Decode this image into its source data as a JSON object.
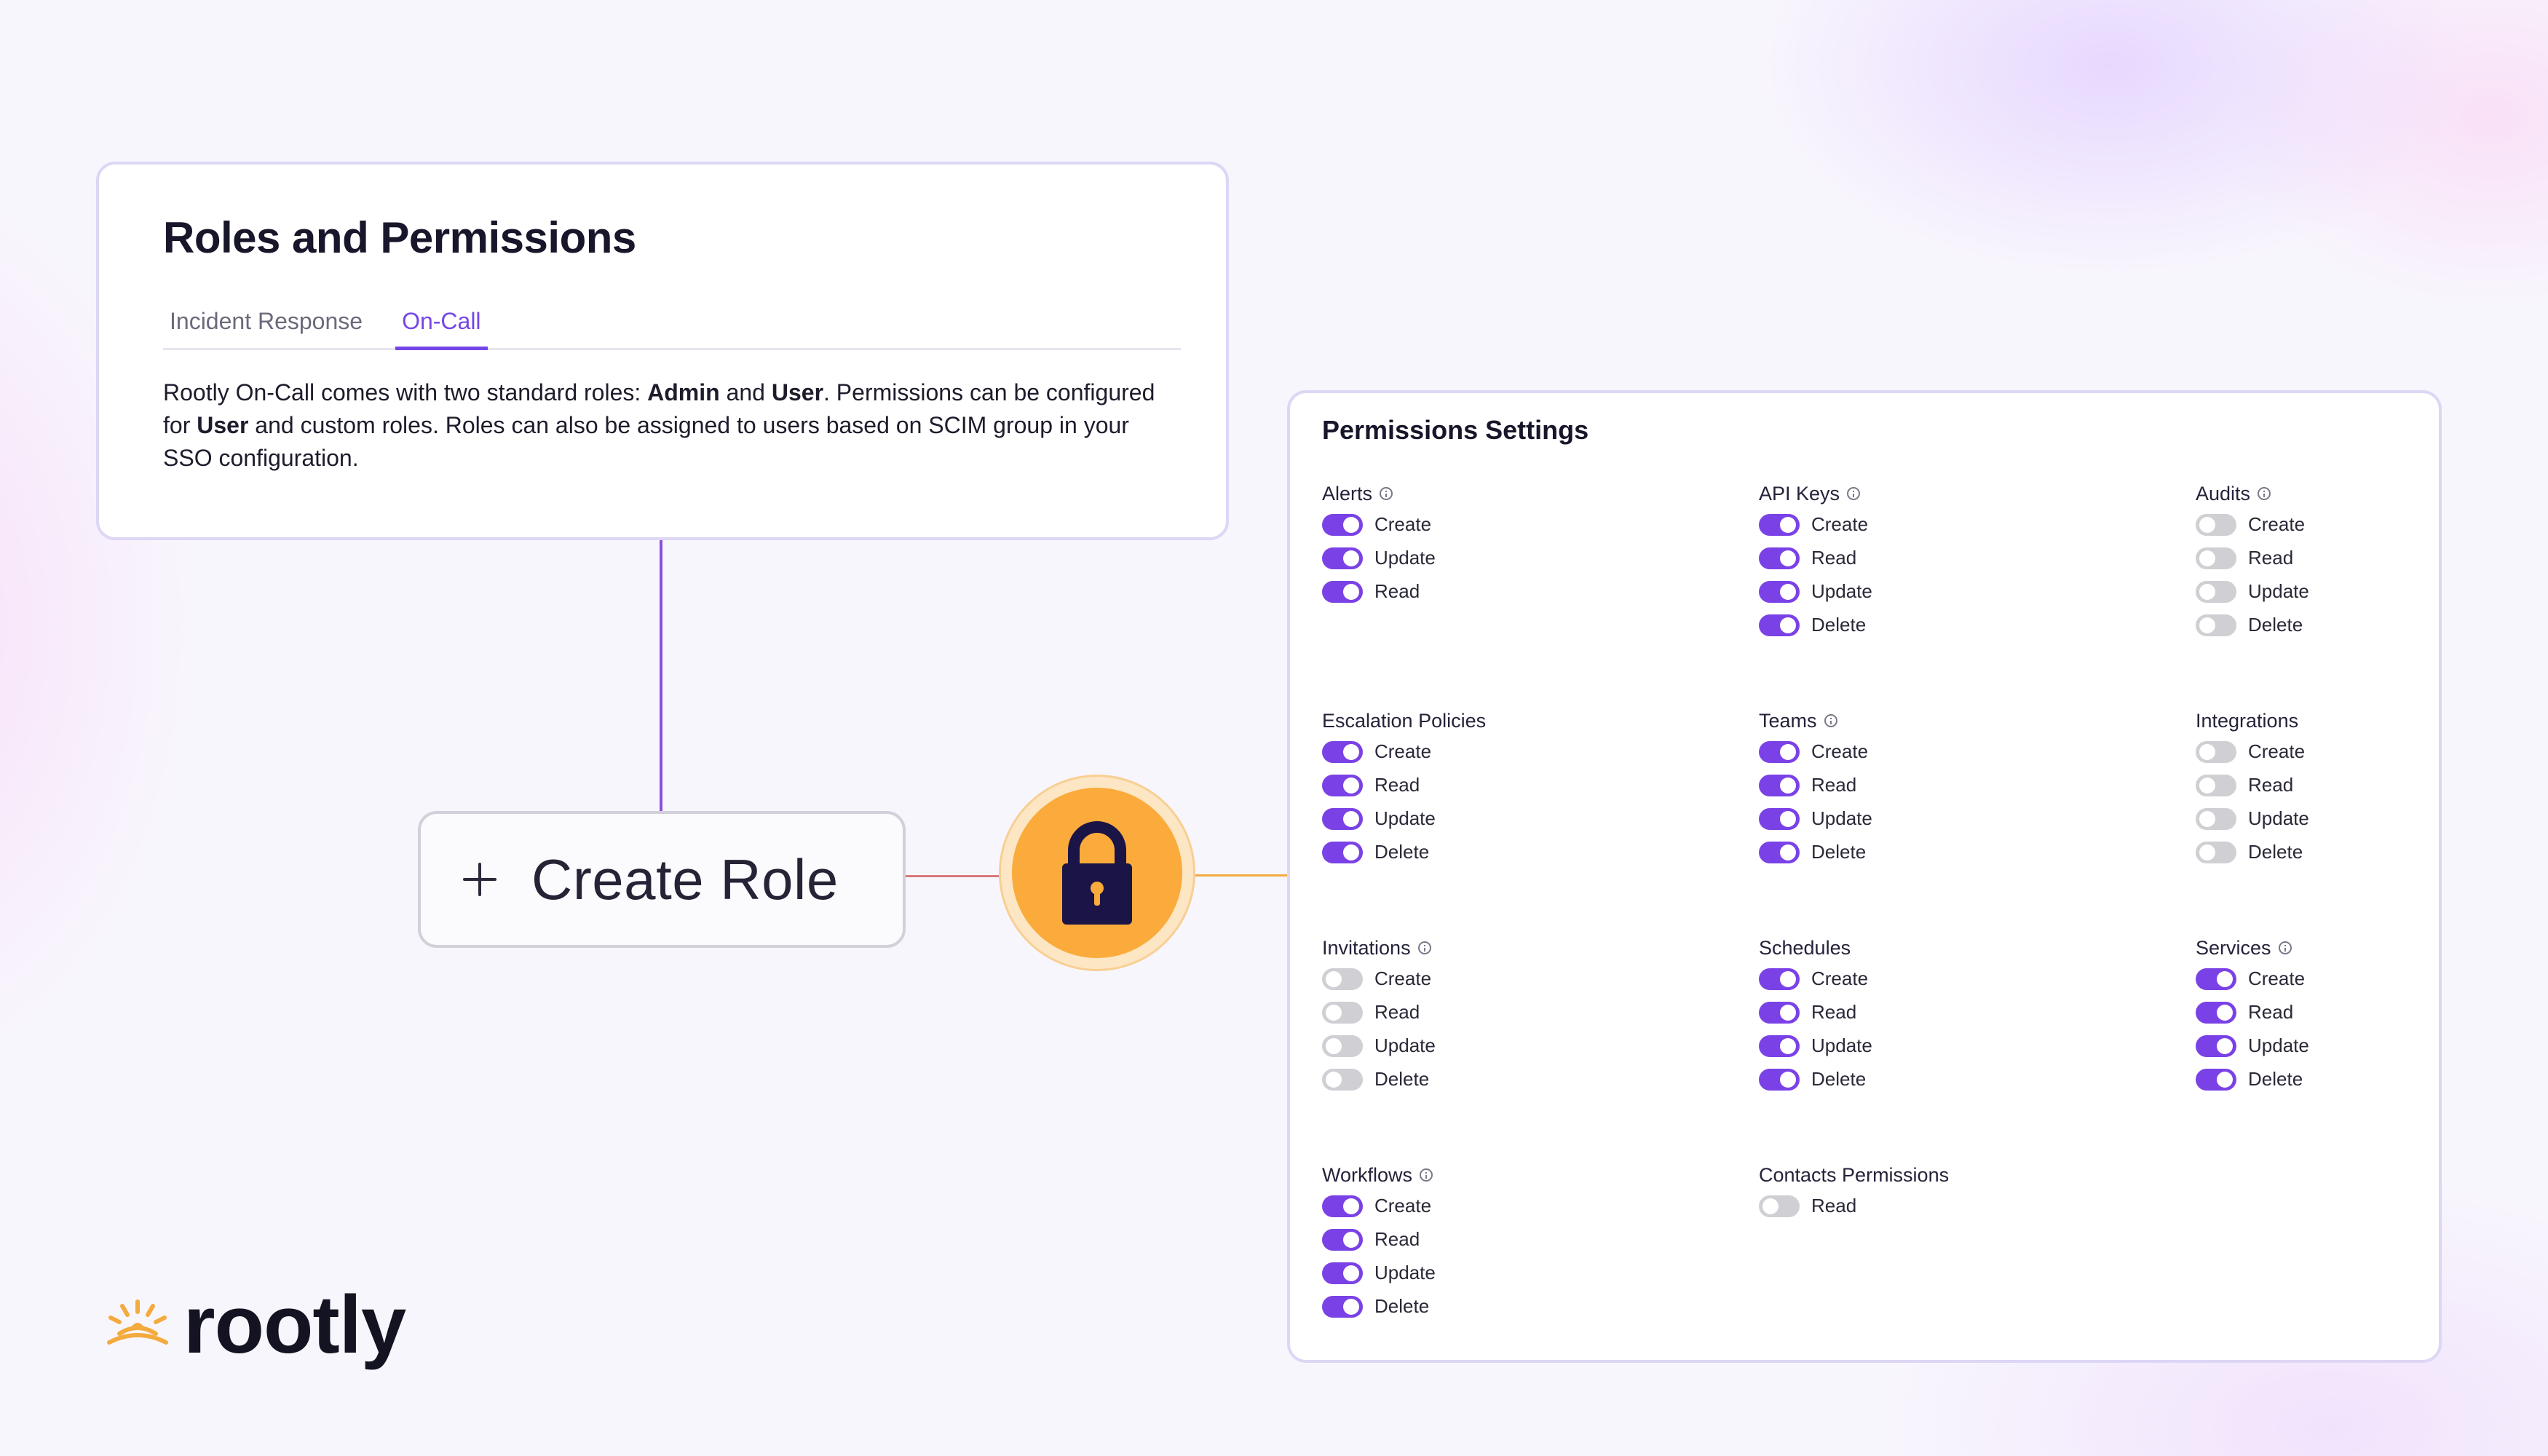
{
  "roles_card": {
    "title": "Roles and Permissions",
    "tabs": [
      {
        "label": "Incident Response",
        "active": false
      },
      {
        "label": "On-Call",
        "active": true
      }
    ],
    "description": {
      "t1": "Rootly On-Call comes with two standard roles: ",
      "b1": "Admin",
      "t2": " and ",
      "b2": "User",
      "t3": ". Permissions can be configured for ",
      "b3": "User",
      "t4": " and custom roles. Roles can also be assigned to users based on SCIM group in your SSO configuration."
    }
  },
  "create_role": {
    "label": "Create Role"
  },
  "colors": {
    "accent": "#7546e8",
    "toggle_on": "#7a42e6",
    "toggle_off": "#cfcfd4",
    "lock": "#fbab3b",
    "lock_body": "#1b1446"
  },
  "permissions": {
    "title": "Permissions Settings",
    "groups": [
      {
        "name": "Alerts",
        "info": true,
        "items": [
          {
            "label": "Create",
            "on": true
          },
          {
            "label": "Update",
            "on": true
          },
          {
            "label": "Read",
            "on": true
          }
        ]
      },
      {
        "name": "API Keys",
        "info": true,
        "items": [
          {
            "label": "Create",
            "on": true
          },
          {
            "label": "Read",
            "on": true
          },
          {
            "label": "Update",
            "on": true
          },
          {
            "label": "Delete",
            "on": true
          }
        ]
      },
      {
        "name": "Audits",
        "info": true,
        "items": [
          {
            "label": "Create",
            "on": false
          },
          {
            "label": "Read",
            "on": false
          },
          {
            "label": "Update",
            "on": false
          },
          {
            "label": "Delete",
            "on": false
          }
        ]
      },
      {
        "name": "Escalation Policies",
        "info": false,
        "items": [
          {
            "label": "Create",
            "on": true
          },
          {
            "label": "Read",
            "on": true
          },
          {
            "label": "Update",
            "on": true
          },
          {
            "label": "Delete",
            "on": true
          }
        ]
      },
      {
        "name": "Teams",
        "info": true,
        "items": [
          {
            "label": "Create",
            "on": true
          },
          {
            "label": "Read",
            "on": true
          },
          {
            "label": "Update",
            "on": true
          },
          {
            "label": "Delete",
            "on": true
          }
        ]
      },
      {
        "name": "Integrations",
        "info": false,
        "items": [
          {
            "label": "Create",
            "on": false
          },
          {
            "label": "Read",
            "on": false
          },
          {
            "label": "Update",
            "on": false
          },
          {
            "label": "Delete",
            "on": false
          }
        ]
      },
      {
        "name": "Invitations",
        "info": true,
        "items": [
          {
            "label": "Create",
            "on": false
          },
          {
            "label": "Read",
            "on": false
          },
          {
            "label": "Update",
            "on": false
          },
          {
            "label": "Delete",
            "on": false
          }
        ]
      },
      {
        "name": "Schedules",
        "info": false,
        "items": [
          {
            "label": "Create",
            "on": true
          },
          {
            "label": "Read",
            "on": true
          },
          {
            "label": "Update",
            "on": true
          },
          {
            "label": "Delete",
            "on": true
          }
        ]
      },
      {
        "name": "Services",
        "info": true,
        "items": [
          {
            "label": "Create",
            "on": true
          },
          {
            "label": "Read",
            "on": true
          },
          {
            "label": "Update",
            "on": true
          },
          {
            "label": "Delete",
            "on": true
          }
        ]
      },
      {
        "name": "Workflows",
        "info": true,
        "items": [
          {
            "label": "Create",
            "on": true
          },
          {
            "label": "Read",
            "on": true
          },
          {
            "label": "Update",
            "on": true
          },
          {
            "label": "Delete",
            "on": true
          }
        ]
      },
      {
        "name": "Contacts Permissions",
        "info": false,
        "items": [
          {
            "label": "Read",
            "on": false
          }
        ]
      }
    ]
  },
  "logo": {
    "text": "rootly",
    "icon": "rootly-sprout-icon",
    "color": "#f3ab3e"
  }
}
